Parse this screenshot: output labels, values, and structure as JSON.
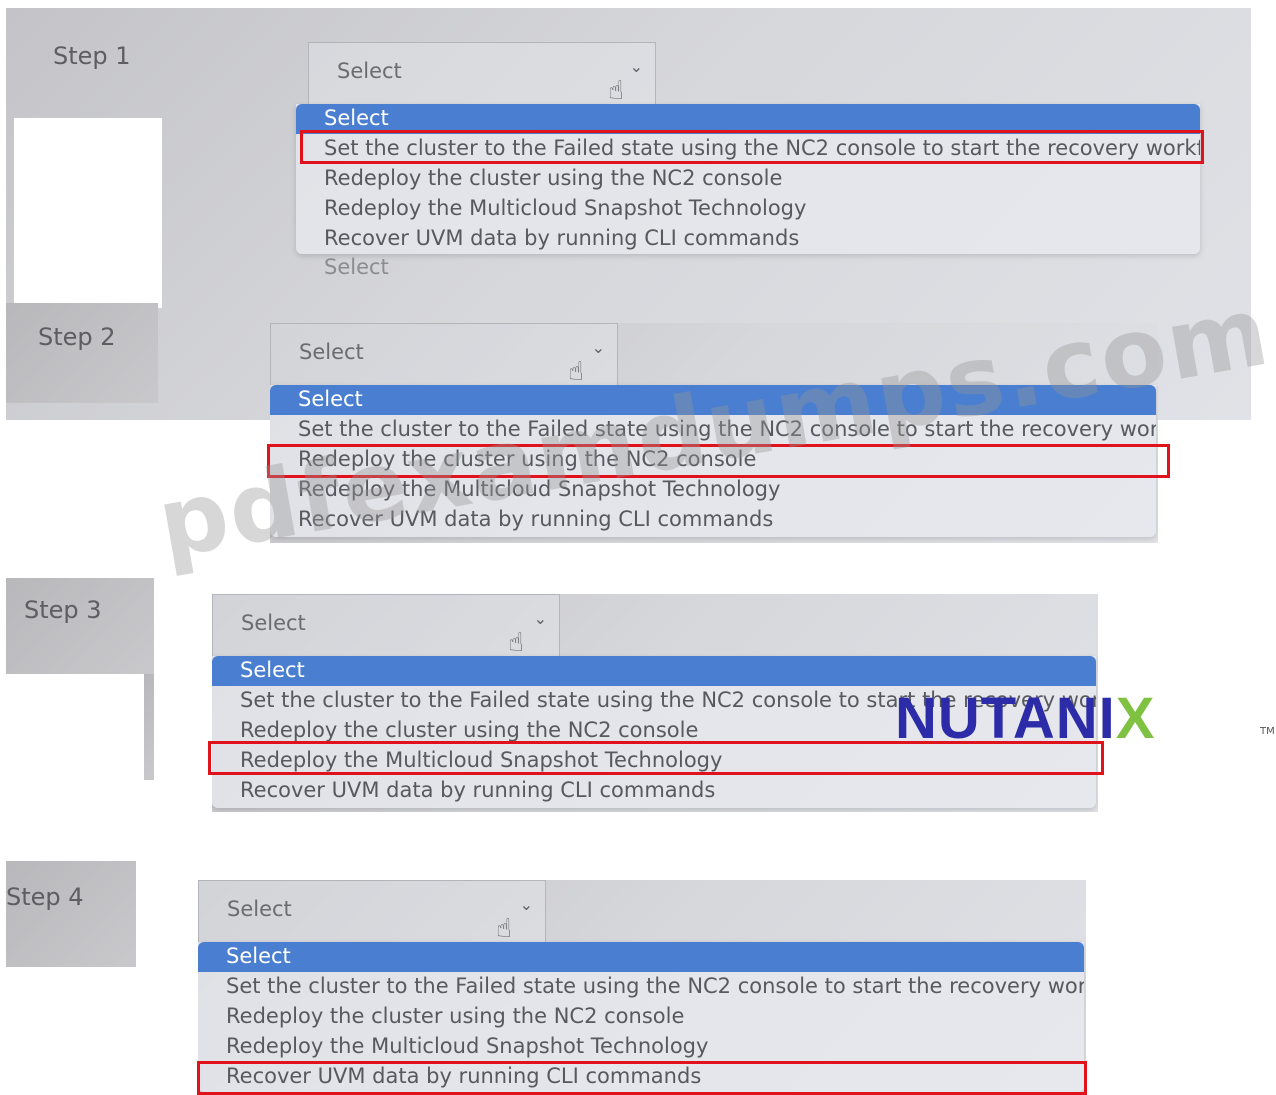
{
  "steps": [
    {
      "label": "Step 1",
      "select_value": "Select",
      "options": [
        "Select",
        "Set the cluster to the Failed state using the NC2 console to start the recovery workflow",
        "Redeploy the cluster using the NC2 console",
        "Redeploy the Multicloud Snapshot Technology",
        "Recover UVM data by running CLI commands"
      ],
      "highlighted_option": "Set the cluster to the Failed state using the NC2 console to start the recovery workflow",
      "next_select_value": "Select"
    },
    {
      "label": "Step 2",
      "select_value": "Select",
      "options": [
        "Select",
        "Set the cluster to the Failed state using the NC2 console to start the recovery workflow",
        "Redeploy the cluster using the NC2 console",
        "Redeploy the Multicloud Snapshot Technology",
        "Recover UVM data by running CLI commands"
      ],
      "highlighted_option": "Redeploy the cluster using the NC2 console"
    },
    {
      "label": "Step 3",
      "select_value": "Select",
      "options": [
        "Select",
        "Set the cluster to the Failed state using the NC2 console to start the recovery workflow",
        "Redeploy the cluster using the NC2 console",
        "Redeploy the Multicloud Snapshot Technology",
        "Recover UVM data by running CLI commands"
      ],
      "highlighted_option": "Redeploy the Multicloud Snapshot Technology"
    },
    {
      "label": "Step 4",
      "select_value": "Select",
      "options": [
        "Select",
        "Set the cluster to the Failed state using the NC2 console to start the recovery workflow",
        "Redeploy the cluster using the NC2 console",
        "Redeploy the Multicloud Snapshot Technology",
        "Recover UVM data by running CLI commands"
      ],
      "highlighted_option": "Recover UVM data by running CLI commands"
    }
  ],
  "watermark": "pdfexamdumps.com",
  "logo": {
    "text_main": "NUTANI",
    "text_x": "X",
    "trademark": "TM"
  },
  "colors": {
    "highlight": "#e0121b",
    "selected_option_bg": "#4a7ed0",
    "logo_blue": "#2c2ba8",
    "logo_green": "#7fc241"
  },
  "icons": {
    "dropdown": "chevron-down-icon",
    "cursor": "hand-pointer-icon"
  }
}
